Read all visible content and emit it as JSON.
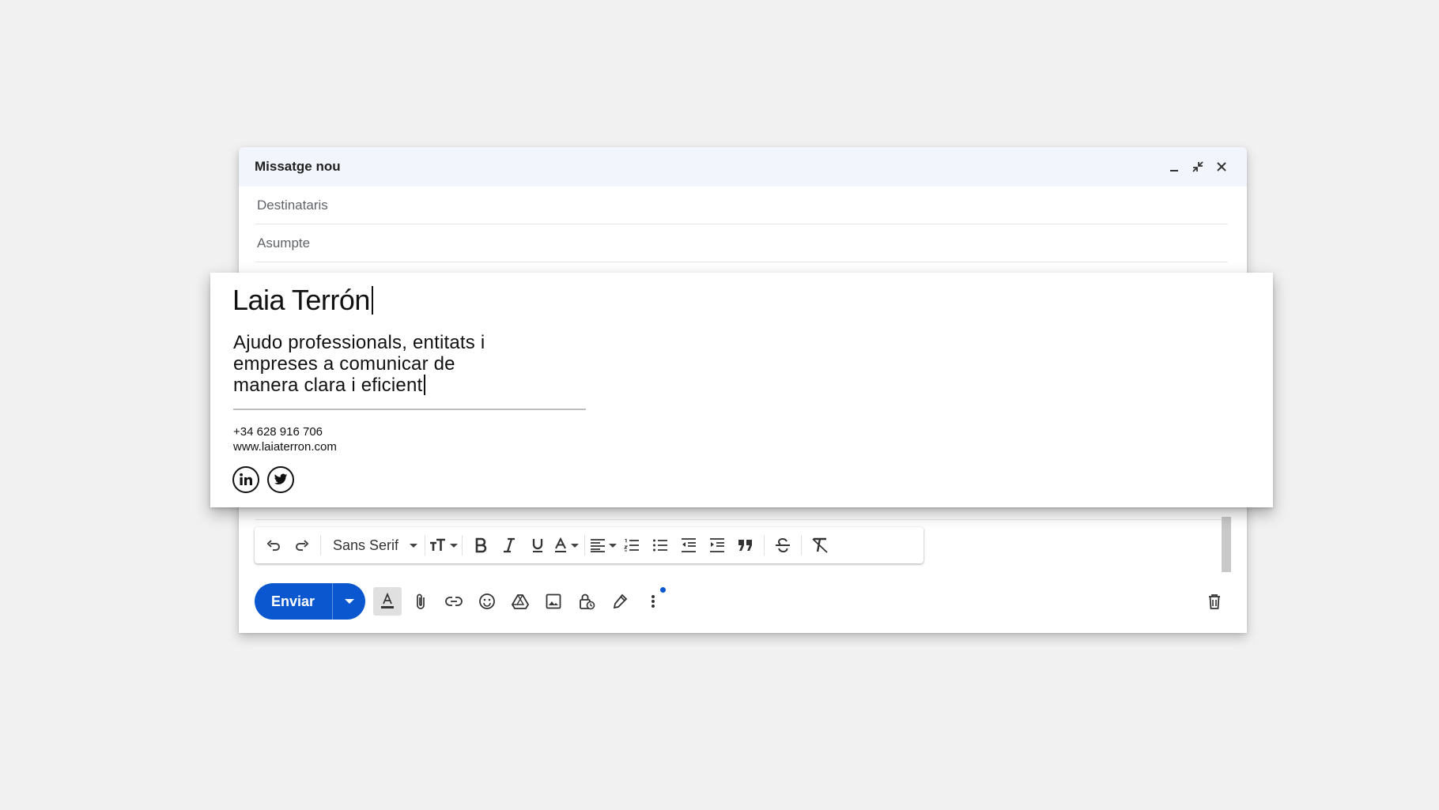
{
  "compose": {
    "title": "Missatge nou",
    "to_placeholder": "Destinataris",
    "subject_placeholder": "Asumpte"
  },
  "signature": {
    "name": "Laia Terrón",
    "tagline_lines": [
      "Ajudo professionals, entitats i",
      "empreses a comunicar de",
      "manera clara i eficient"
    ],
    "phone": "+34 628 916 706",
    "website": "www.laiaterron.com",
    "social": [
      "linkedin",
      "twitter"
    ]
  },
  "toolbar": {
    "font": "Sans Serif",
    "icons": [
      "undo-icon",
      "redo-icon",
      "font-size-icon",
      "bold-icon",
      "italic-icon",
      "underline-icon",
      "text-color-icon",
      "align-icon",
      "numbered-list-icon",
      "bulleted-list-icon",
      "indent-less-icon",
      "indent-more-icon",
      "quote-icon",
      "strikethrough-icon",
      "remove-formatting-icon"
    ]
  },
  "bottom": {
    "send_label": "Enviar",
    "icons": [
      "formatting-options-icon",
      "attach-icon",
      "link-icon",
      "emoji-icon",
      "drive-icon",
      "photo-icon",
      "confidential-icon",
      "signature-icon",
      "more-options-icon",
      "delete-icon"
    ]
  },
  "colors": {
    "send": "#0b57d0",
    "header_bg": "#f2f6fc",
    "page_bg": "#f1f1f1"
  }
}
